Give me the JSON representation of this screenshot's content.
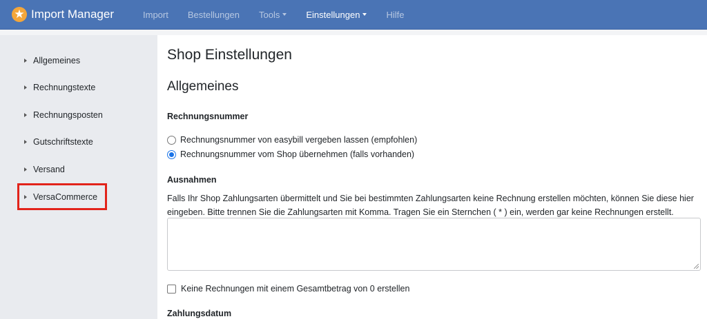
{
  "navbar": {
    "brand": "Import Manager",
    "brand_icon": "star-icon",
    "items": [
      {
        "label": "Import",
        "active": false,
        "dropdown": false
      },
      {
        "label": "Bestellungen",
        "active": false,
        "dropdown": false
      },
      {
        "label": "Tools",
        "active": false,
        "dropdown": true
      },
      {
        "label": "Einstellungen",
        "active": true,
        "dropdown": true
      },
      {
        "label": "Hilfe",
        "active": false,
        "dropdown": false
      }
    ],
    "colors": {
      "background": "#4a74b5",
      "brand_icon": "#f4a63a"
    }
  },
  "sidebar": {
    "items": [
      {
        "label": "Allgemeines"
      },
      {
        "label": "Rechnungstexte"
      },
      {
        "label": "Rechnungsposten"
      },
      {
        "label": "Gutschriftstexte"
      },
      {
        "label": "Versand"
      },
      {
        "label": "VersaCommerce"
      }
    ],
    "highlighted_item": "VersaCommerce",
    "highlight_color": "#e2231a"
  },
  "main": {
    "page_title": "Shop Einstellungen",
    "section_title": "Allgemeines",
    "invoice_number": {
      "label": "Rechnungsnummer",
      "options": [
        {
          "label": "Rechnungsnummer von easybill vergeben lassen (empfohlen)",
          "checked": false
        },
        {
          "label": "Rechnungsnummer vom Shop übernehmen (falls vorhanden)",
          "checked": true
        }
      ]
    },
    "exceptions": {
      "label": "Ausnahmen",
      "help_text": "Falls Ihr Shop Zahlungsarten übermittelt und Sie bei bestimmten Zahlungsarten keine Rechnung erstellen möchten, können Sie diese hier eingeben. Bitte trennen Sie die Zahlungsarten mit Komma. Tragen Sie ein Sternchen ( * ) ein, werden gar keine Rechnungen erstellt.",
      "textarea_value": ""
    },
    "zero_total_checkbox": {
      "label": "Keine Rechnungen mit einem Gesamtbetrag von 0 erstellen",
      "checked": false
    },
    "payment_date_label": "Zahlungsdatum"
  }
}
